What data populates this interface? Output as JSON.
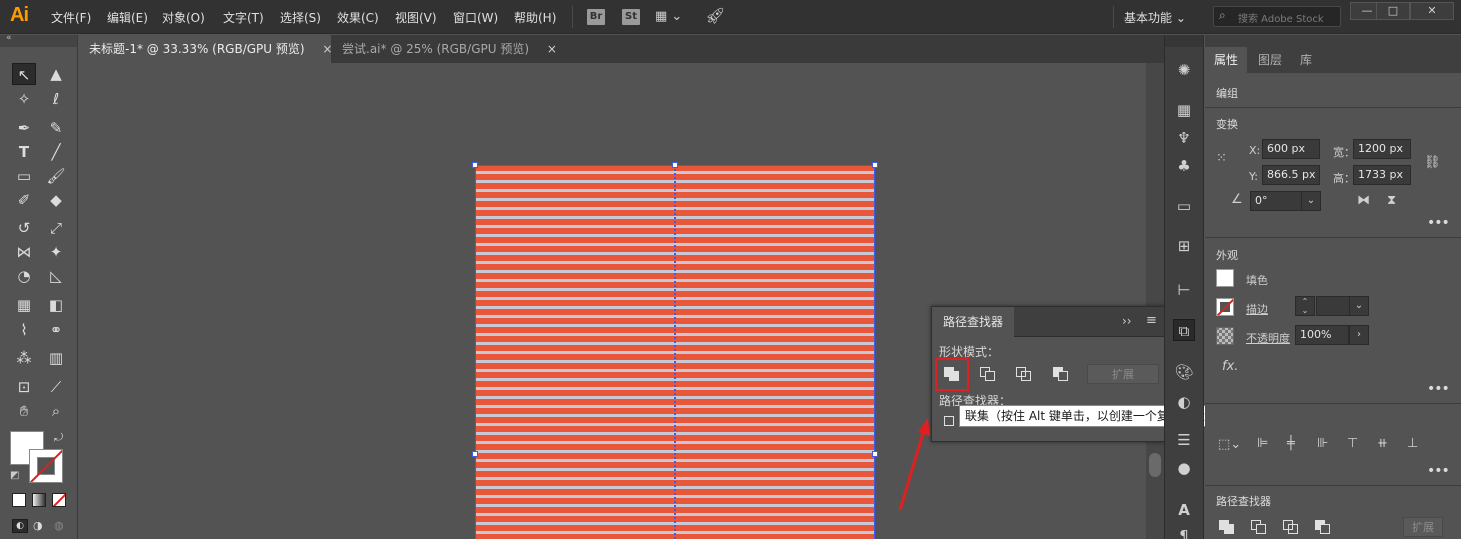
{
  "app": {
    "logo": "Ai",
    "menu": [
      "文件(F)",
      "编辑(E)",
      "对象(O)",
      "文字(T)",
      "选择(S)",
      "效果(C)",
      "视图(V)",
      "窗口(W)",
      "帮助(H)"
    ],
    "bridge_label": "Br",
    "stock_label": "St",
    "workspace_label": "基本功能",
    "search_placeholder": "搜索 Adobe Stock"
  },
  "tabs": [
    {
      "label": "未标题-1* @ 33.33% (RGB/GPU 预览)",
      "close": "×"
    },
    {
      "label": "尝试.ai* @ 25% (RGB/GPU 预览)",
      "close": "×"
    }
  ],
  "pathfinder_panel": {
    "title": "路径查找器",
    "shape_modes_label": "形状模式：",
    "pathfinders_label": "路径查找器：",
    "expand_label": "扩展",
    "collapse_glyph": "››",
    "menu_glyph": "≡"
  },
  "tooltip": {
    "text": "联集（按住 Alt 键单击，以创建一个复合形状，并添加到形状区域）"
  },
  "properties_panel": {
    "tabs": [
      "属性",
      "图层",
      "库"
    ],
    "group_label": "编组",
    "transform_title": "变换",
    "x_label": "X:",
    "x_value": "600 px",
    "y_label": "Y:",
    "y_value": "866.5 px",
    "width_label": "宽：",
    "width_value": "1200 px",
    "height_label": "高：",
    "height_value": "1733 px",
    "angle_value": "0°",
    "appearance_title": "外观",
    "fill_label": "填色",
    "stroke_label": "描边",
    "opacity_label": "不透明度",
    "opacity_value": "100%",
    "fx_label": "fx.",
    "pathfinder_title": "路径查找器",
    "expand_label": "扩展",
    "more": "•••"
  },
  "colors": {
    "stripe_red": "#e8573a",
    "stripe_light": "#c9c9d6",
    "selection_blue": "#3f5ce8",
    "highlight_red": "#e21f1f",
    "logo_orange": "#ff9a00"
  }
}
